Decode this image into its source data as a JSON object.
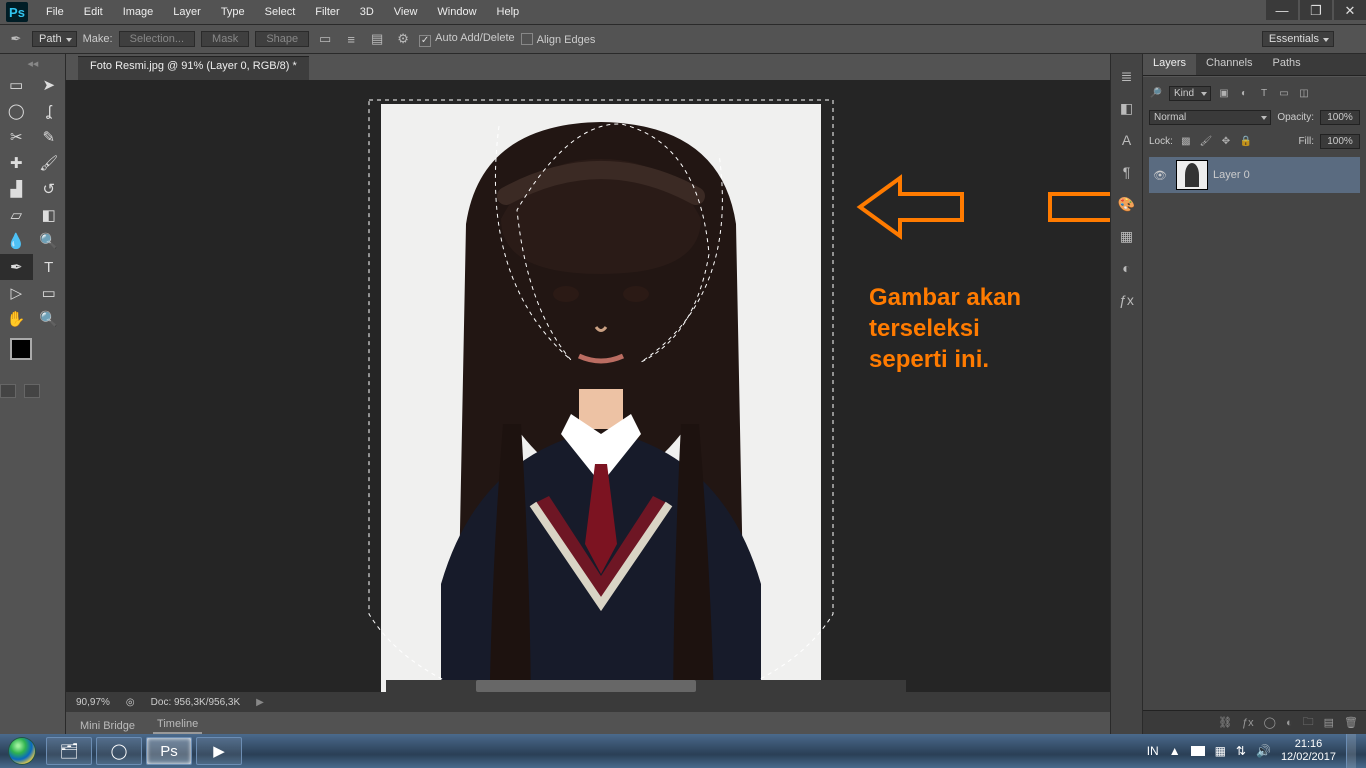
{
  "menu": [
    "File",
    "Edit",
    "Image",
    "Layer",
    "Type",
    "Select",
    "Filter",
    "3D",
    "View",
    "Window",
    "Help"
  ],
  "options": {
    "mode": "Path",
    "make": "Make:",
    "selection": "Selection...",
    "mask": "Mask",
    "shape": "Shape",
    "autoadd": "Auto Add/Delete",
    "alignedges": "Align Edges"
  },
  "workspace": "Essentials",
  "doc_tab": "Foto Resmi.jpg @ 91% (Layer 0, RGB/8) *",
  "annotation": "Gambar akan\nterseleksi\nseperti ini.",
  "status": {
    "zoom": "90,97%",
    "doc": "Doc: 956,3K/956,3K"
  },
  "bottom_tabs": [
    "Mini Bridge",
    "Timeline"
  ],
  "panels": {
    "tabs": [
      "Layers",
      "Channels",
      "Paths"
    ],
    "kind": "Kind",
    "blend": "Normal",
    "opacity_lbl": "Opacity:",
    "opacity_val": "100%",
    "lock_lbl": "Lock:",
    "fill_lbl": "Fill:",
    "fill_val": "100%",
    "layer_name": "Layer 0"
  },
  "tray": {
    "lang": "IN",
    "time": "21:16",
    "date": "12/02/2017"
  }
}
